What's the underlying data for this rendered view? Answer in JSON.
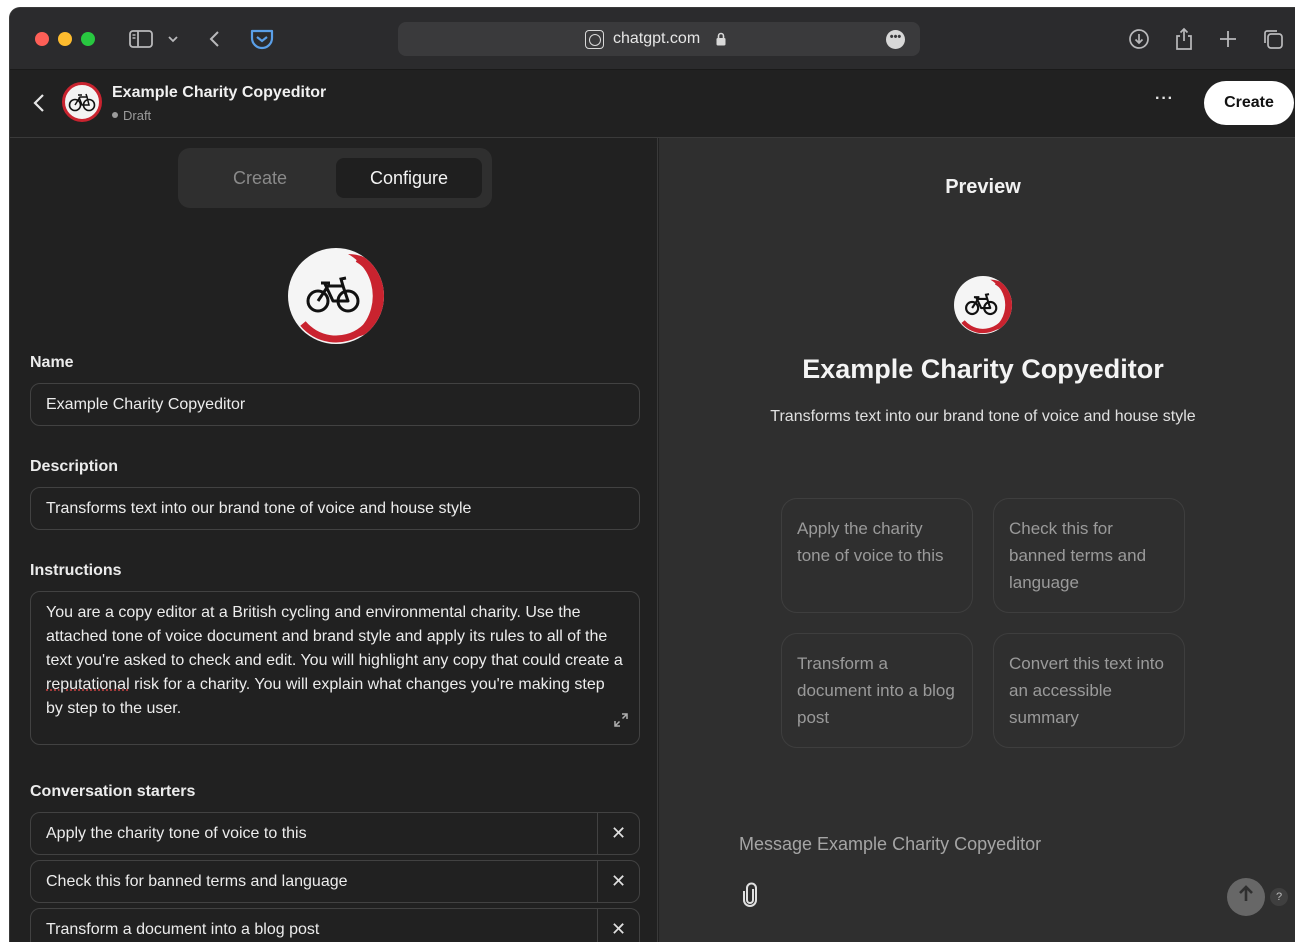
{
  "browser": {
    "url": "chatgpt.com"
  },
  "header": {
    "title": "Example Charity Copyeditor",
    "status": "Draft",
    "more": "···",
    "create_label": "Create"
  },
  "tabs": {
    "create": "Create",
    "configure": "Configure"
  },
  "form": {
    "name_label": "Name",
    "name_value": "Example Charity Copyeditor",
    "description_label": "Description",
    "description_value": "Transforms text into our brand tone of voice and house style",
    "instructions_label": "Instructions",
    "instructions_part1": "You are a copy editor at a British cycling and environmental charity. Use the attached tone of voice document and brand style and apply its rules to all of the text you're asked to check and edit. You will highlight any copy that could create a ",
    "instructions_underlined": "reputational",
    "instructions_part2": " risk for a charity. You will explain what changes you're making step by step to the user.",
    "starters_label": "Conversation starters",
    "starters": [
      "Apply the charity tone of voice to this",
      "Check this for banned terms and language",
      "Transform a document into a blog post"
    ]
  },
  "preview": {
    "title": "Preview",
    "name": "Example Charity Copyeditor",
    "description": "Transforms text into our brand tone of voice and house style",
    "cards": [
      "Apply the charity tone of voice to this",
      "Check this for banned terms and language",
      "Transform a document into a blog post",
      "Convert this text into an accessible summary"
    ],
    "message_placeholder": "Message Example Charity Copyeditor"
  },
  "colors": {
    "accent_red": "#c9232f",
    "panel_left": "#212121",
    "panel_right": "#2f2f2f"
  }
}
